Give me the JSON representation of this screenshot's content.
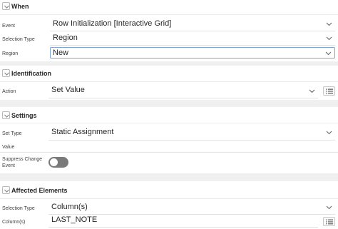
{
  "sections": {
    "when": {
      "title": "When"
    },
    "identification": {
      "title": "Identification"
    },
    "settings": {
      "title": "Settings"
    },
    "affected": {
      "title": "Affected Elements"
    }
  },
  "when": {
    "event_label": "Event",
    "event_value": "Row Initialization [Interactive Grid]",
    "selection_type_label": "Selection Type",
    "selection_type_value": "Region",
    "region_label": "Region",
    "region_value": "New"
  },
  "identification": {
    "action_label": "Action",
    "action_value": "Set Value"
  },
  "settings": {
    "set_type_label": "Set Type",
    "set_type_value": "Static Assignment",
    "value_label": "Value",
    "value_value": "",
    "suppress_label_line1": "Suppress Change",
    "suppress_label_line2": "Event",
    "suppress_on": false
  },
  "affected": {
    "selection_type_label": "Selection Type",
    "selection_type_value": "Column(s)",
    "columns_label": "Column(s)",
    "columns_value": "LAST_NOTE"
  },
  "icons": {
    "collapse": "chevron-down-icon",
    "list": "list-icon"
  }
}
